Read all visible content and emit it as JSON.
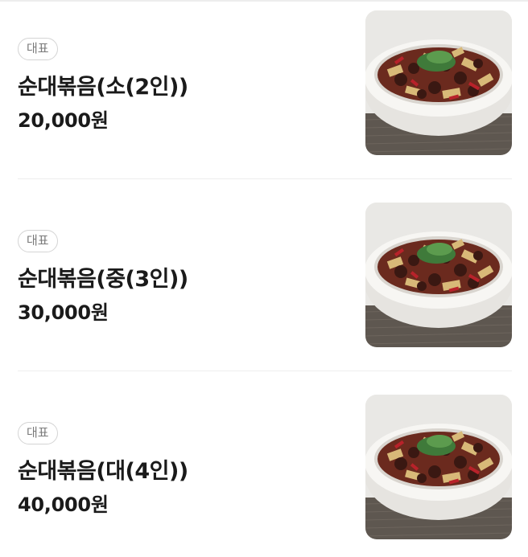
{
  "colors": {
    "text": "#1a1a1a",
    "badge_border": "#d4d4d4",
    "badge_text": "#7a7a7a",
    "divider": "#eeeeee"
  },
  "menu": {
    "items": [
      {
        "badge": "대표",
        "name": "순대볶음(소(2인))",
        "price": "20,000원",
        "image_icon": "stir-fried-sundae-dish-image"
      },
      {
        "badge": "대표",
        "name": "순대볶음(중(3인))",
        "price": "30,000원",
        "image_icon": "stir-fried-sundae-dish-image"
      },
      {
        "badge": "대표",
        "name": "순대볶음(대(4인))",
        "price": "40,000원",
        "image_icon": "stir-fried-sundae-dish-image"
      }
    ]
  }
}
